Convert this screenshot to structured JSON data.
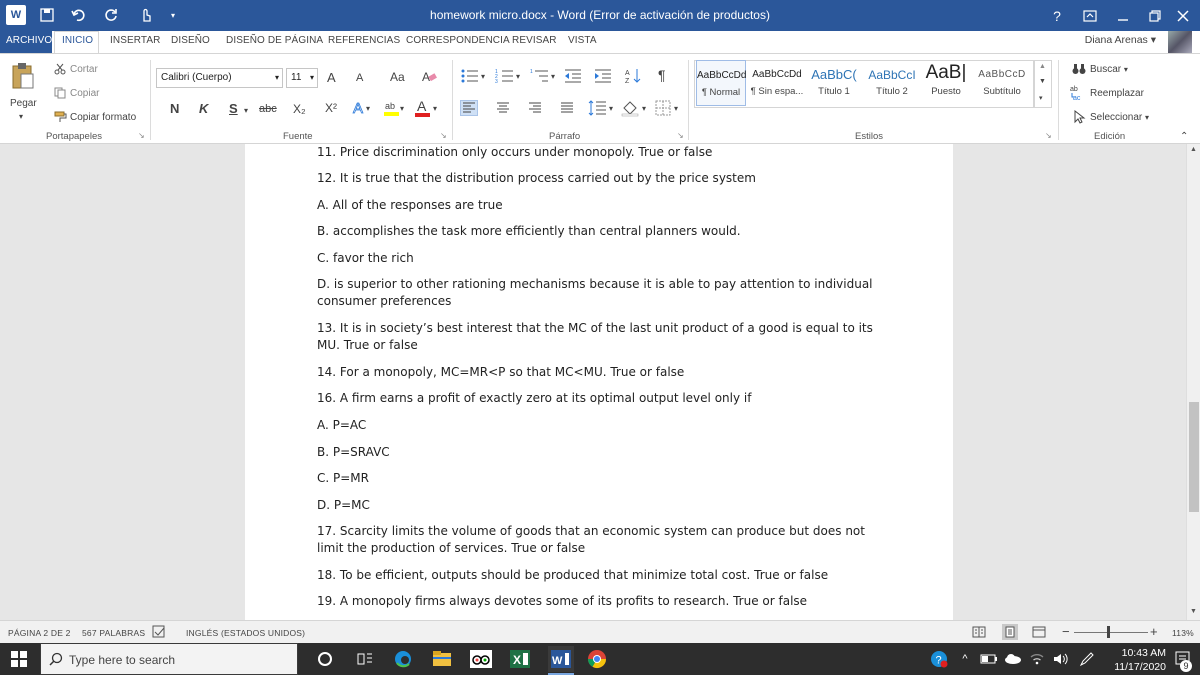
{
  "titlebar": {
    "title": "homework micro.docx -  Word (Error de activación de productos)",
    "app_icon": "word-icon",
    "help": "?"
  },
  "tabs": [
    "ARCHIVO",
    "INICIO",
    "INSERTAR",
    "DISEÑO",
    "DISEÑO DE PÁGINA",
    "REFERENCIAS",
    "CORRESPONDENCIA",
    "REVISAR",
    "VISTA"
  ],
  "active_tab": "INICIO",
  "user": "Diana Arenas",
  "ribbon": {
    "clipboard": {
      "paste": "Pegar",
      "cut": "Cortar",
      "copy": "Copiar",
      "format_painter": "Copiar formato",
      "group": "Portapapeles"
    },
    "font": {
      "name": "Calibri (Cuerpo)",
      "size": "11",
      "group": "Fuente",
      "bold": "N",
      "italic": "K",
      "underline": "S",
      "strike": "abc",
      "grow": "A",
      "shrink": "A",
      "case": "Aa",
      "sub": "X₂",
      "sup": "X²"
    },
    "paragraph": {
      "group": "Párrafo"
    },
    "styles": {
      "group": "Estilos",
      "items": [
        {
          "sample": "AaBbCcDd",
          "name": "¶ Normal"
        },
        {
          "sample": "AaBbCcDd",
          "name": "¶ Sin espa..."
        },
        {
          "sample": "AaBbC(",
          "name": "Título 1"
        },
        {
          "sample": "AaBbCcI",
          "name": "Título 2"
        },
        {
          "sample": "AaB|",
          "name": "Puesto"
        },
        {
          "sample": "AaBbCcD",
          "name": "Subtítulo"
        }
      ]
    },
    "editing": {
      "group": "Edición",
      "find": "Buscar",
      "replace": "Reemplazar",
      "select": "Seleccionar"
    }
  },
  "document": {
    "paragraphs": [
      "11. Price discrimination only occurs under monopoly. True or false",
      "12. It is true that the distribution process carried out by the price system",
      "A. All of the responses are true",
      "B. accomplishes the task more efficiently than central planners would.",
      "C. favor the rich",
      "D. is superior to other rationing mechanisms because it is able to pay attention to individual consumer preferences",
      "13. It is in society’s best interest that the MC of the last unit product of a good is equal to its MU. True or false",
      "14. For a monopoly, MC=MR<P so that MC<MU. True or false",
      "16. A firm earns a profit of exactly zero at its optimal output level only if",
      "A. P=AC",
      "B. P=SRAVC",
      "C. P=MR",
      "D. P=MC",
      "17. Scarcity limits the volume of goods that an economic system can produce but does not limit the production of services. True or false",
      "18. To be efficient, outputs should be produced that minimize total cost. True or false",
      "19. A monopoly firms always devotes some of its profits to research. True or false"
    ]
  },
  "statusbar": {
    "page": "PÁGINA 2 DE 2",
    "words": "567 PALABRAS",
    "language": "INGLÉS (ESTADOS UNIDOS)",
    "zoom": "113%",
    "zoom_minus": "−",
    "zoom_plus": "+"
  },
  "taskbar": {
    "search_placeholder": "Type here to search",
    "time": "10:43 AM",
    "date": "11/17/2020",
    "notifications": "9"
  },
  "colors": {
    "word_blue": "#2b579a",
    "taskbar": "#2d2d2d",
    "doc_bg": "#e6e6e6"
  }
}
